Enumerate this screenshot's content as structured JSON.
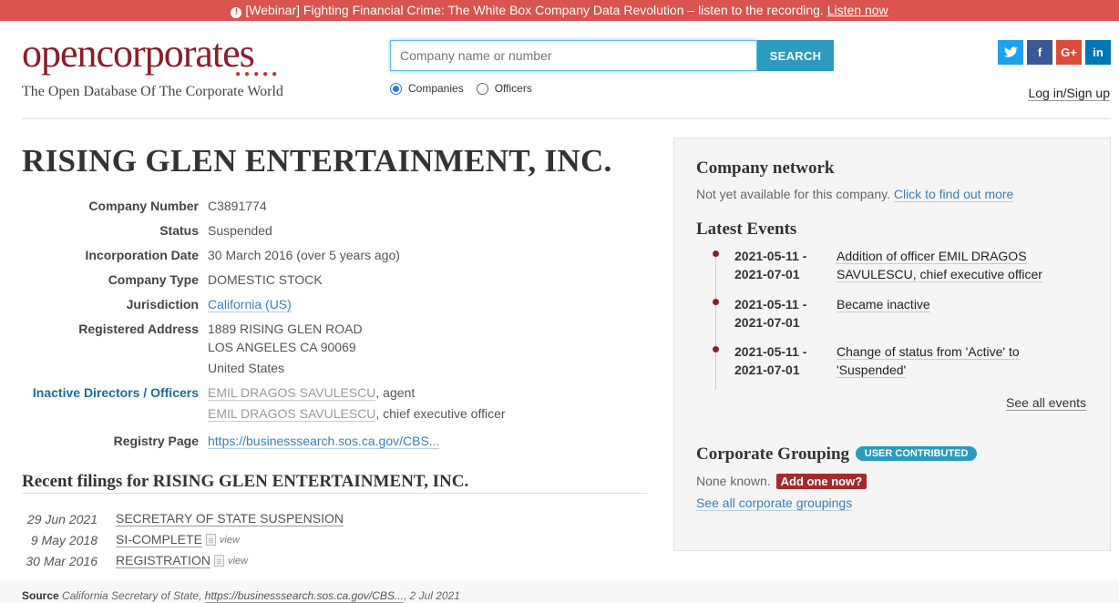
{
  "banner": {
    "icon": "exclamation-circle-icon",
    "text": "[Webinar] Fighting Financial Crime: The White Box Company Data Revolution – listen to the recording.",
    "link": "Listen now",
    "color": "#d9534f"
  },
  "header": {
    "logo_open": "open",
    "logo_corp": "corporates",
    "tagline": "The Open Database Of The Corporate World",
    "search_placeholder": "Company name or number",
    "search_button": "SEARCH",
    "radio_companies": "Companies",
    "radio_officers": "Officers",
    "selected_radio": "Companies",
    "login": "Log in/Sign up",
    "social": [
      "twitter-icon",
      "facebook-icon",
      "google-plus-icon",
      "linkedin-icon"
    ],
    "social_glyphs": {
      "twitter": "🐦",
      "facebook": "f",
      "google": "G+",
      "linkedin": "in"
    }
  },
  "company": {
    "name": "RISING GLEN ENTERTAINMENT, INC.",
    "fields": {
      "number_label": "Company Number",
      "number": "C3891774",
      "status_label": "Status",
      "status": "Suspended",
      "inc_label": "Incorporation Date",
      "inc": "30 March 2016 (over 5 years ago)",
      "type_label": "Company Type",
      "type": "DOMESTIC STOCK",
      "jur_label": "Jurisdiction",
      "jur": "California (US)",
      "addr_label": "Registered Address",
      "addr1": "1889 RISING GLEN ROAD",
      "addr2": "LOS ANGELES CA 90069",
      "addr3": "United States",
      "officers_label": "Inactive Directors / Officers",
      "officer1_name": "EMIL DRAGOS SAVULESCU",
      "officer1_role": ", agent",
      "officer2_name": "EMIL DRAGOS SAVULESCU",
      "officer2_role": ", chief executive officer",
      "registry_label": "Registry Page",
      "registry": "https://businesssearch.sos.ca.gov/CBS..."
    }
  },
  "filings": {
    "heading": "Recent filings for RISING GLEN ENTERTAINMENT, INC.",
    "view_label": "view",
    "items": [
      {
        "date": "29 Jun 2021",
        "title": "SECRETARY OF STATE SUSPENSION"
      },
      {
        "date": "9 May 2018",
        "title": "SI-COMPLETE"
      },
      {
        "date": "30 Mar 2016",
        "title": "REGISTRATION"
      }
    ]
  },
  "source": {
    "label": "Source",
    "text": "California Secretary of State,",
    "link": "https://businesssearch.sos.ca.gov/CBS...",
    "date": ", 2 Jul 2021"
  },
  "panel": {
    "network_heading": "Company network",
    "network_text": "Not yet available for this company.",
    "network_link": "Click to find out more",
    "events_heading": "Latest Events",
    "events": [
      {
        "date1": "2021-05-11 -",
        "date2": "2021-07-01",
        "desc1": "Addition of officer EMIL DRAGOS",
        "desc2": "SAVULESCU, chief executive officer"
      },
      {
        "date1": "2021-05-11 -",
        "date2": "2021-07-01",
        "desc1": "Became inactive",
        "desc2": ""
      },
      {
        "date1": "2021-05-11 -",
        "date2": "2021-07-01",
        "desc1": "Change of status from 'Active' to",
        "desc2": "'Suspended'"
      }
    ],
    "see_all_events": "See all events",
    "grouping_heading": "Corporate Grouping",
    "grouping_badge": "USER CONTRIBUTED",
    "none_known": "None known.",
    "add_one": "Add one now?",
    "see_all_groupings": "See all corporate groupings"
  }
}
